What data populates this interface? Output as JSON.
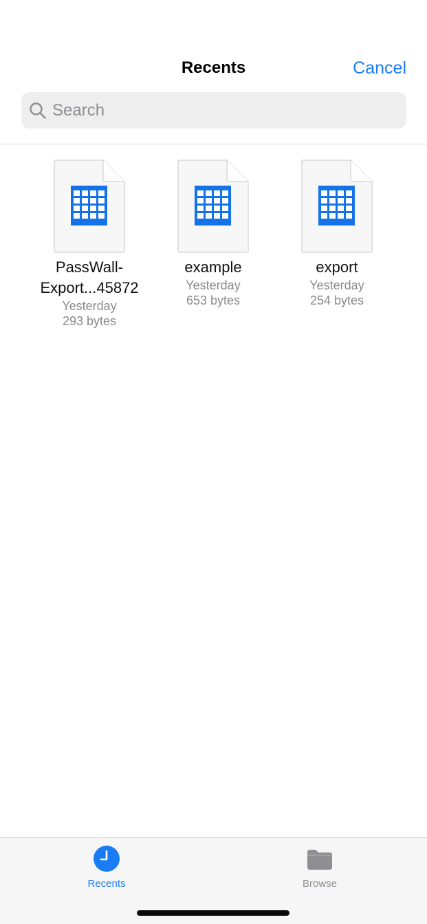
{
  "nav": {
    "title": "Recents",
    "cancel_label": "Cancel"
  },
  "search": {
    "placeholder": "Search",
    "value": "",
    "icon": "search-icon"
  },
  "files": [
    {
      "name_line1": "PassWall-",
      "name_line2": "Export...45872",
      "modified": "Yesterday",
      "size": "293 bytes",
      "icon": "spreadsheet-file-icon"
    },
    {
      "name_line1": "example",
      "name_line2": "",
      "modified": "Yesterday",
      "size": "653 bytes",
      "icon": "spreadsheet-file-icon"
    },
    {
      "name_line1": "export",
      "name_line2": "",
      "modified": "Yesterday",
      "size": "254 bytes",
      "icon": "spreadsheet-file-icon"
    }
  ],
  "tabbar": {
    "tabs": [
      {
        "label": "Recents",
        "icon": "clock-icon",
        "active": true
      },
      {
        "label": "Browse",
        "icon": "folder-icon",
        "active": false
      }
    ]
  },
  "colors": {
    "accent": "#1a7cf5",
    "secondary_text": "#8a8a8e",
    "grid_blue": "#1473e6"
  }
}
